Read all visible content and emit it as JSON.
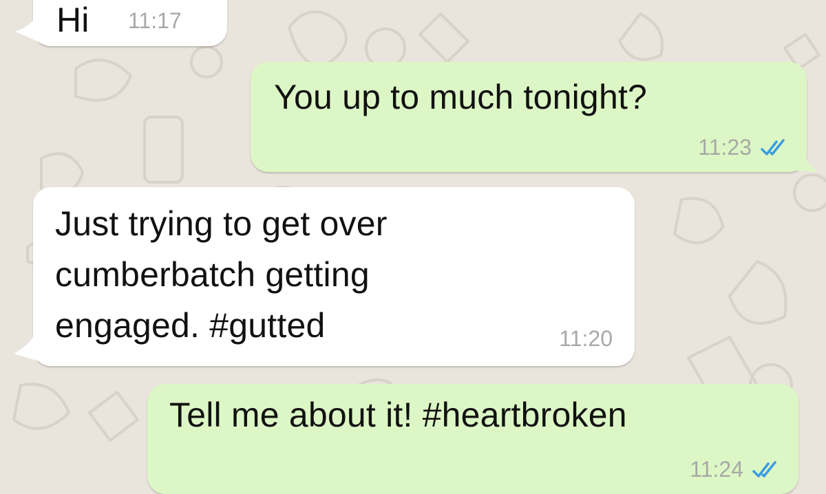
{
  "chat": {
    "messages": [
      {
        "direction": "incoming",
        "text": "Hi",
        "time": "11:17"
      },
      {
        "direction": "outgoing",
        "text": "You up to much tonight?",
        "time": "11:23",
        "status": "read",
        "status_icon": "double-check-icon",
        "status_color": "#3b9ce3"
      },
      {
        "direction": "incoming",
        "lines": [
          "Just trying to get over",
          "cumberbatch getting",
          "engaged. #gutted"
        ],
        "time": "11:20"
      },
      {
        "direction": "outgoing",
        "text": "Tell me about it! #heartbroken",
        "time": "11:24",
        "status": "read",
        "status_icon": "double-check-icon",
        "status_color": "#3b9ce3"
      }
    ]
  },
  "colors": {
    "wallpaper": "#e9e4dc",
    "incoming_bubble": "#ffffff",
    "outgoing_bubble": "#dcf7c5",
    "timestamp": "#a7a9a6",
    "read_ticks": "#3b9ce3"
  }
}
